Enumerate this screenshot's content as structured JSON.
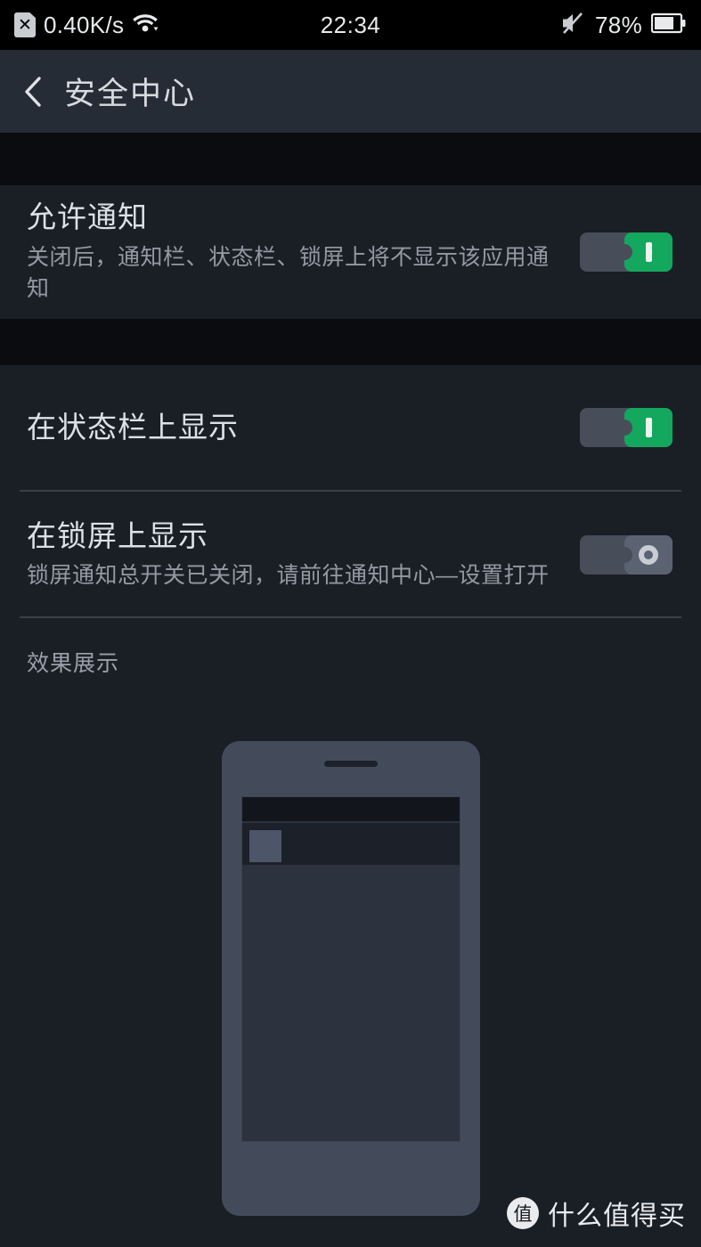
{
  "statusbar": {
    "sim_icon": "sim-card-x-icon",
    "network_speed": "0.40K/s",
    "wifi_icon": "wifi-icon",
    "time": "22:34",
    "mute_icon": "mute-icon",
    "battery_percent": "78%",
    "battery_icon": "battery-icon",
    "battery_level": 78
  },
  "header": {
    "back_icon": "back-chevron-icon",
    "title": "安全中心"
  },
  "settings": {
    "allow_notifications": {
      "title": "允许通知",
      "subtitle": "关闭后，通知栏、状态栏、锁屏上将不显示该应用通知",
      "toggle_state": "on",
      "toggle_glyph": "I"
    },
    "show_in_statusbar": {
      "title": "在状态栏上显示",
      "toggle_state": "on",
      "toggle_glyph": "I"
    },
    "show_on_lockscreen": {
      "title": "在锁屏上显示",
      "subtitle": "锁屏通知总开关已关闭，请前往通知中心—设置打开",
      "toggle_state": "off",
      "toggle_glyph": "O"
    }
  },
  "preview": {
    "label": "效果展示",
    "device_icon": "phone-mockup-icon"
  },
  "watermark": {
    "logo_char": "值",
    "text": "什么值得买"
  },
  "colors": {
    "accent_green": "#14a85f",
    "card_bg": "#1a1f26",
    "header_bg": "#262c35",
    "page_bg": "#0a0c0f",
    "title_text": "#dde1e6",
    "sub_text": "#939aa3"
  }
}
